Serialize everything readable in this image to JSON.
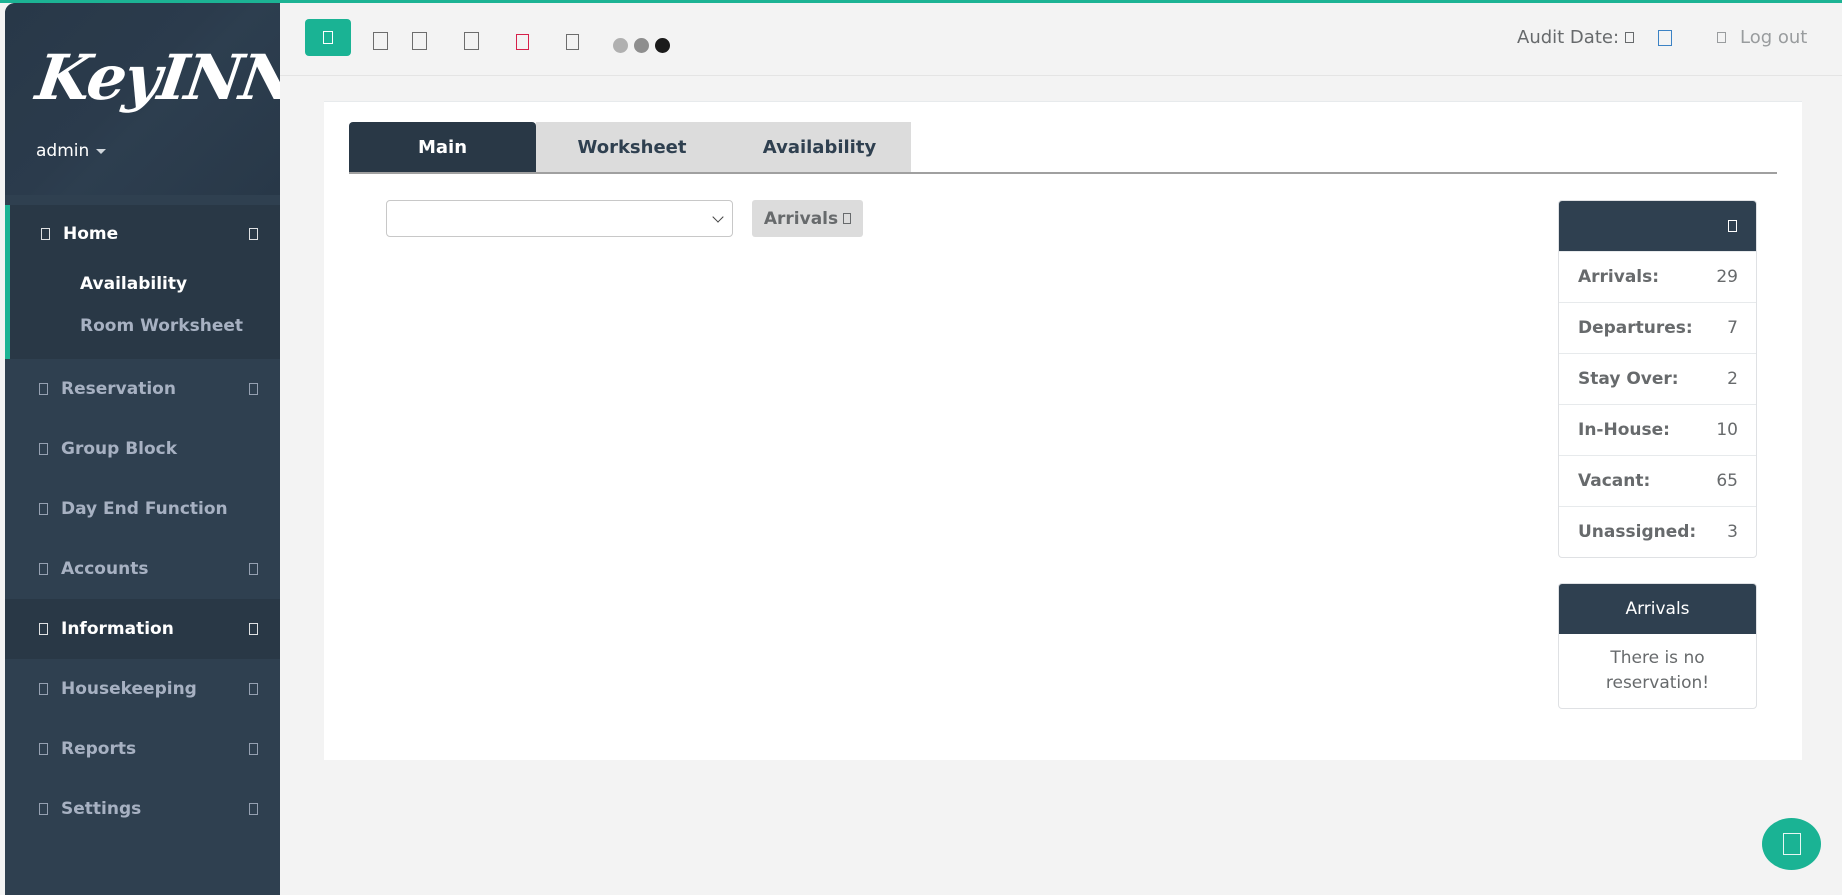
{
  "app": {
    "brand": "KeyINN",
    "accent_color": "#1ab394",
    "sidebar_color": "#2f4050"
  },
  "user_menu": {
    "label": "admin",
    "icon": "caret-down-icon"
  },
  "sidebar": {
    "items": [
      {
        "label": "Home",
        "icon": "home-icon",
        "has_arrow": true,
        "active": true,
        "children": [
          {
            "label": "Availability",
            "active": true
          },
          {
            "label": "Room Worksheet",
            "active": false
          }
        ]
      },
      {
        "label": "Reservation",
        "icon": "reservation-icon",
        "has_arrow": true
      },
      {
        "label": "Group Block",
        "icon": "group-icon",
        "has_arrow": false
      },
      {
        "label": "Day End Function",
        "icon": "day-end-icon",
        "has_arrow": false
      },
      {
        "label": "Accounts",
        "icon": "accounts-icon",
        "has_arrow": true
      },
      {
        "label": "Information",
        "icon": "info-icon",
        "has_arrow": true,
        "highlighted": true
      },
      {
        "label": "Housekeeping",
        "icon": "housekeeping-icon",
        "has_arrow": true
      },
      {
        "label": "Reports",
        "icon": "reports-icon",
        "has_arrow": true
      },
      {
        "label": "Settings",
        "icon": "settings-icon",
        "has_arrow": true
      }
    ]
  },
  "header": {
    "toolbar_icons": [
      "menu-toggle-icon",
      "document-icon",
      "copy-icon",
      "print-icon",
      "bookmark-icon",
      "file-icon"
    ],
    "theme_dots": [
      "#b0b0b0",
      "#8e8e8e",
      "#1b1b1b"
    ],
    "audit_label": "Audit Date:",
    "logout_label": "Log out"
  },
  "main": {
    "tabs": [
      {
        "label": "Main",
        "active": true
      },
      {
        "label": "Worksheet",
        "active": false
      },
      {
        "label": "Availability",
        "active": false
      }
    ],
    "filter_select": {
      "value": ""
    },
    "arrivals_button": "Arrivals"
  },
  "stats": {
    "rows": [
      {
        "label": "Arrivals:",
        "value": "29"
      },
      {
        "label": "Departures:",
        "value": "7"
      },
      {
        "label": "Stay Over:",
        "value": "2"
      },
      {
        "label": "In-House:",
        "value": "10"
      },
      {
        "label": "Vacant:",
        "value": "65"
      },
      {
        "label": "Unassigned:",
        "value": "3"
      }
    ]
  },
  "arrivals_panel": {
    "title": "Arrivals",
    "empty_message": "There is no reservation!"
  }
}
